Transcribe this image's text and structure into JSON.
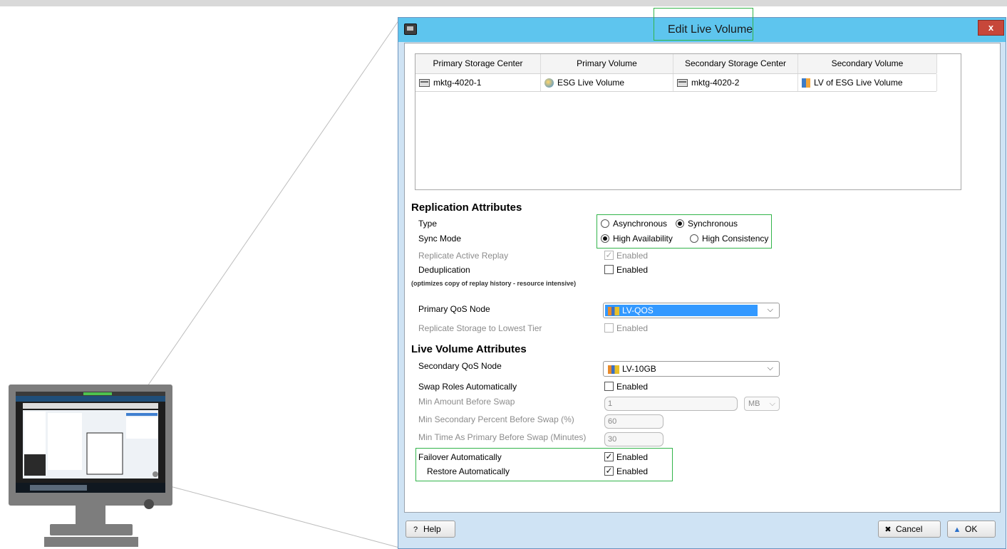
{
  "dialog": {
    "title": "Edit Live Volume",
    "close_label": "x"
  },
  "volume_table": {
    "columns": [
      "Primary Storage Center",
      "Primary Volume",
      "Secondary Storage Center",
      "Secondary Volume"
    ],
    "rows": [
      [
        "mktg-4020-1",
        "ESG Live Volume",
        "mktg-4020-2",
        "LV of ESG Live Volume"
      ]
    ]
  },
  "replication": {
    "heading": "Replication Attributes",
    "type_label": "Type",
    "type_options": [
      "Asynchronous",
      "Synchronous"
    ],
    "type_selected": "Synchronous",
    "sync_mode_label": "Sync Mode",
    "sync_mode_options": [
      "High Availability",
      "High Consistency"
    ],
    "sync_mode_selected": "High Availability",
    "replicate_active_replay_label": "Replicate Active Replay",
    "replicate_active_replay_value": "Enabled",
    "replicate_active_replay_checked": true,
    "deduplication_label": "Deduplication",
    "deduplication_value": "Enabled",
    "deduplication_checked": false,
    "dedup_note": "(optimizes copy of replay history - resource intensive)",
    "primary_qos_label": "Primary QoS Node",
    "primary_qos_value": "LV-QOS",
    "replicate_lowest_tier_label": "Replicate Storage to Lowest Tier",
    "replicate_lowest_tier_value": "Enabled",
    "replicate_lowest_tier_checked": false
  },
  "live_volume": {
    "heading": "Live Volume Attributes",
    "secondary_qos_label": "Secondary QoS Node",
    "secondary_qos_value": "LV-10GB",
    "swap_roles_label": "Swap Roles Automatically",
    "swap_roles_value": "Enabled",
    "swap_roles_checked": false,
    "min_amount_label": "Min Amount Before Swap",
    "min_amount_value": "1",
    "min_amount_unit": "MB",
    "min_secondary_percent_label": "Min Secondary Percent Before Swap (%)",
    "min_secondary_percent_value": "60",
    "min_time_label": "Min Time As Primary Before Swap (Minutes)",
    "min_time_value": "30",
    "failover_label": "Failover Automatically",
    "failover_value": "Enabled",
    "failover_checked": true,
    "restore_label": "Restore Automatically",
    "restore_value": "Enabled",
    "restore_checked": true
  },
  "footer": {
    "help_label": "Help",
    "cancel_label": "Cancel",
    "ok_label": "OK"
  },
  "colors": {
    "titlebar": "#5ec5ee",
    "highlight_box": "#32b44a",
    "selection": "#3399ff"
  }
}
